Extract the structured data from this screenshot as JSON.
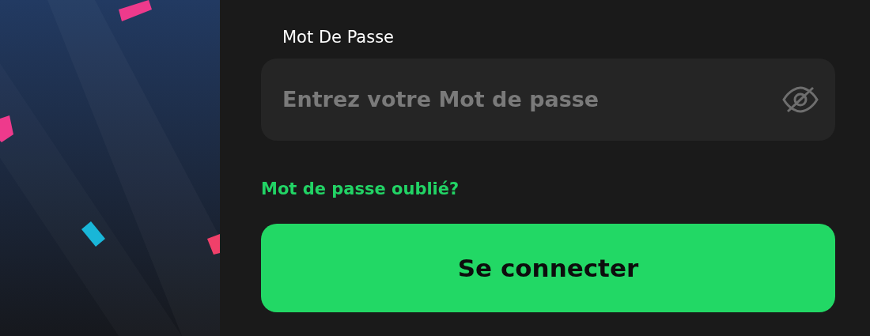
{
  "password": {
    "label": "Mot De Passe",
    "placeholder": "Entrez votre Mot de passe"
  },
  "forgot_link": "Mot de passe oublié?",
  "submit_button": "Se connecter"
}
